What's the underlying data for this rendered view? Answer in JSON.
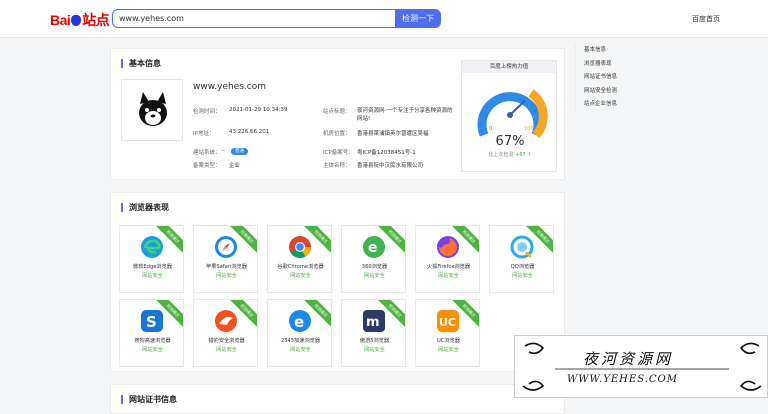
{
  "header": {
    "logo_text": "Bai",
    "logo_tail": "站点",
    "search_value": "www.yehes.com",
    "search_button": "检测一下",
    "home_link": "百度首页"
  },
  "basic": {
    "section_title": "基本信息",
    "site_url": "www.yehes.com",
    "fields_left": [
      {
        "label": "检测时间：",
        "value": "2021-01-29 10:34:39"
      },
      {
        "label": "IP地址：",
        "value": "43.226.66.201"
      },
      {
        "label": "建站系统：",
        "value": "--"
      },
      {
        "label": "备案类型：",
        "value": "企业"
      }
    ],
    "system_badge": "普通",
    "fields_right": [
      {
        "label": "站点标题：",
        "value": "夜河资源网-一个专注于分享各种资源的网站!"
      },
      {
        "label": "机房位置：",
        "value": "香港县莱浦镇英尔曾遭区吴福"
      },
      {
        "label": "ICP备案号：",
        "value": "粤ICP备12038451号-1"
      },
      {
        "label": "主体名称：",
        "value": "香港县阮中汉民水有限公司"
      }
    ],
    "gauge": {
      "title": "百度上榜热力值",
      "percent_text": "67%",
      "percent": 67,
      "tick_min": "0",
      "tick_mid": "50",
      "tick_max": "100",
      "sub_prefix": "比上次检测",
      "sub_delta": "+67 ↑"
    }
  },
  "right_nav": [
    "基本信息",
    "浏览器表现",
    "网站证书信息",
    "网站安全检测",
    "站点企业信息"
  ],
  "browsers": {
    "section_title": "浏览器表现",
    "ribbon": "检测通过",
    "status": "网站安全",
    "items": [
      {
        "name": "微软Edge浏览器",
        "icon": "edge-icon"
      },
      {
        "name": "苹果Safari浏览器",
        "icon": "safari-icon"
      },
      {
        "name": "谷歌Chrome浏览器",
        "icon": "chrome-icon"
      },
      {
        "name": "360浏览器",
        "icon": "360-browser-icon"
      },
      {
        "name": "火狐Firefox浏览器",
        "icon": "firefox-icon"
      },
      {
        "name": "QQ浏览器",
        "icon": "qq-browser-icon"
      },
      {
        "name": "搜狗高速浏览器",
        "icon": "sogou-icon"
      },
      {
        "name": "猎豹安全浏览器",
        "icon": "cheetah-icon"
      },
      {
        "name": "2345加速浏览器",
        "icon": "2345-browser-icon"
      },
      {
        "name": "傲游5浏览器",
        "icon": "maxthon-icon"
      },
      {
        "name": "UC浏览器",
        "icon": "uc-browser-icon"
      }
    ]
  },
  "next_section_title": "网站证书信息",
  "watermark": {
    "title": "夜河资源网",
    "url": "WWW.YEHES.COM"
  },
  "colors": {
    "accent": "#4e6ef2",
    "safe": "#4fb341",
    "badge": "#2e8ae6"
  }
}
